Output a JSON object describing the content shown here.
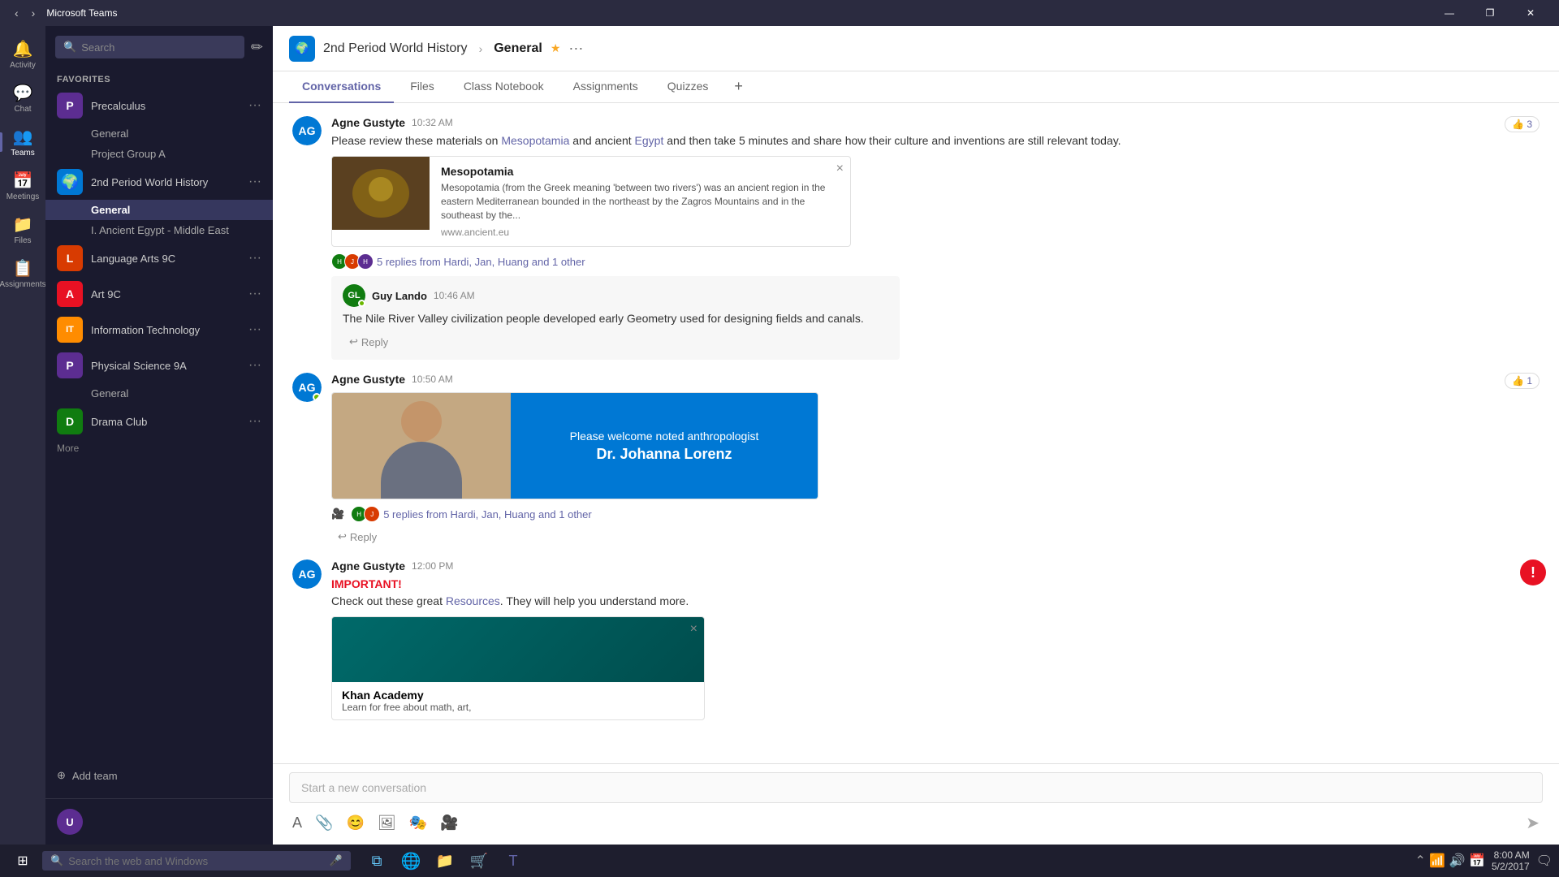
{
  "titlebar": {
    "app_title": "Microsoft Teams",
    "nav_back": "‹",
    "nav_forward": "›",
    "btn_minimize": "—",
    "btn_restore": "❐",
    "btn_close": "✕"
  },
  "rail": {
    "items": [
      {
        "label": "Activity",
        "icon": "🔔",
        "id": "activity"
      },
      {
        "label": "Chat",
        "icon": "💬",
        "id": "chat"
      },
      {
        "label": "Teams",
        "icon": "👥",
        "id": "teams",
        "active": true
      },
      {
        "label": "Meetings",
        "icon": "📅",
        "id": "meetings"
      },
      {
        "label": "Files",
        "icon": "📁",
        "id": "files"
      },
      {
        "label": "Assignments",
        "icon": "📋",
        "id": "assignments"
      }
    ]
  },
  "sidebar": {
    "search_placeholder": "Search",
    "section_label": "Favorites",
    "teams": [
      {
        "id": "precalculus",
        "name": "Precalculus",
        "avatar_color": "#5c2d91",
        "avatar_letter": "P",
        "channels": [
          "General",
          "Project Group A"
        ],
        "expanded": true
      },
      {
        "id": "world-history",
        "name": "2nd Period World History",
        "avatar_color": "#0078d4",
        "avatar_letter": "🌍",
        "channels": [
          "General",
          "I. Ancient Egypt - Middle East"
        ],
        "expanded": true,
        "selected_channel": "General"
      },
      {
        "id": "language-arts",
        "name": "Language Arts 9C",
        "avatar_color": "#d83b01",
        "avatar_letter": "L",
        "channels": [],
        "expanded": false
      },
      {
        "id": "art-9c",
        "name": "Art 9C",
        "avatar_color": "#e81123",
        "avatar_letter": "A",
        "channels": [],
        "expanded": false
      },
      {
        "id": "info-tech",
        "name": "Information Technology",
        "avatar_color": "#ff8c00",
        "avatar_letter": "IT",
        "channels": [],
        "expanded": false
      },
      {
        "id": "physical-science",
        "name": "Physical Science 9A",
        "avatar_color": "#5c2d91",
        "avatar_letter": "P",
        "channels": [
          "General"
        ],
        "expanded": true
      },
      {
        "id": "drama-club",
        "name": "Drama Club",
        "avatar_color": "#107c10",
        "avatar_letter": "D",
        "channels": [],
        "expanded": false
      }
    ],
    "add_team_label": "Add team",
    "more_label": "More"
  },
  "channel_header": {
    "team_name": "2nd Period World History",
    "separator": ">",
    "channel_name": "General",
    "star_icon": "★",
    "more_icon": "···"
  },
  "tabs": [
    {
      "label": "Conversations",
      "active": true
    },
    {
      "label": "Files",
      "active": false
    },
    {
      "label": "Class Notebook",
      "active": false
    },
    {
      "label": "Assignments",
      "active": false
    },
    {
      "label": "Quizzes",
      "active": false
    },
    {
      "label": "+",
      "active": false
    }
  ],
  "messages": [
    {
      "id": "msg1",
      "sender": "Agne Gustyte",
      "time": "10:32 AM",
      "avatar_color": "#0078d4",
      "avatar_initials": "AG",
      "likes": 3,
      "text_before": "Please review these materials on ",
      "link1_text": "Mesopotamia",
      "text_middle": " and ancient ",
      "link2_text": "Egypt",
      "text_after": " and then take 5 minutes and share how their culture and inventions are still relevant today.",
      "card": {
        "title": "Mesopotamia",
        "description": "Mesopotamia (from the Greek meaning 'between two rivers') was an ancient region in the eastern Mediterranean bounded in the northeast by the Zagros Mountains and in the southeast by the...",
        "url": "www.ancient.eu"
      },
      "replies_text": "5 replies from Hardi, Jan, Huang and 1 other",
      "sub_message": {
        "sender": "Guy Lando",
        "time": "10:46 AM",
        "avatar_color": "#107c10",
        "avatar_initials": "GL",
        "online": true,
        "text": "The Nile River Valley civilization people developed early Geometry used for designing fields and canals.",
        "reply_label": "Reply"
      }
    },
    {
      "id": "msg2",
      "sender": "Agne Gustyte",
      "time": "10:50 AM",
      "avatar_color": "#0078d4",
      "avatar_initials": "AG",
      "online": true,
      "likes": 1,
      "image_card": {
        "welcome_text": "Please welcome noted anthropologist",
        "name": "Dr. Johanna Lorenz"
      },
      "replies_text": "5 replies from Hardi, Jan, Huang and 1 other",
      "reply_label": "Reply"
    },
    {
      "id": "msg3",
      "sender": "Agne Gustyte",
      "time": "12:00 PM",
      "avatar_color": "#0078d4",
      "avatar_initials": "AG",
      "important": true,
      "important_label": "IMPORTANT!",
      "text": "Check out these great ",
      "link_text": "Resources",
      "text_after": ". They will help you understand more.",
      "khan_card": {
        "title": "Khan Academy",
        "description": "Learn for free about math, art,"
      }
    }
  ],
  "composer": {
    "placeholder": "Start a new conversation",
    "tools": [
      "format",
      "attach",
      "emoji",
      "gif",
      "sticker",
      "video"
    ],
    "send_icon": "➤"
  },
  "taskbar": {
    "search_placeholder": "Search the web and Windows",
    "time": "8:00 AM",
    "date": "5/2/2017",
    "apps": [
      "⊞",
      "🌐",
      "📁",
      "🛒",
      "👜"
    ]
  }
}
